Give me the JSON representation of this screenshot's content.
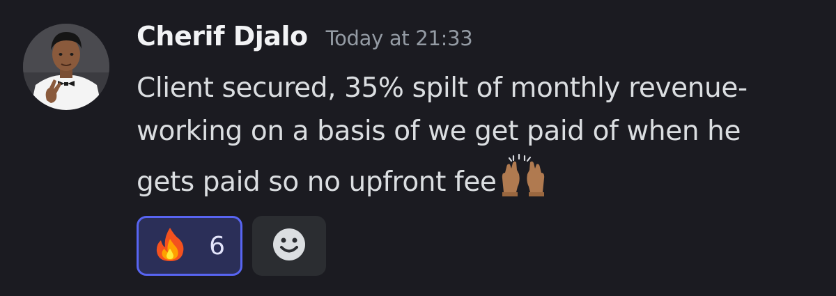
{
  "message": {
    "author": "Cherif Djalo",
    "timestamp": "Today at 21:33",
    "content_lines": [
      "Client secured, 35% spilt of monthly revenue-",
      "working on a basis of we get paid of when he",
      "gets paid so no upfront fee"
    ],
    "trailing_emoji": "raising-hands-icon"
  },
  "reactions": [
    {
      "emoji": "fire-icon",
      "count": "6",
      "selected": true
    }
  ],
  "add_reaction": {
    "icon": "smiley-face-icon"
  },
  "colors": {
    "background": "#1b1b21",
    "author": "#f2f3f5",
    "timestamp": "#949ba4",
    "text": "#dbdee1",
    "reaction_selected_bg": "#2b2f58",
    "reaction_selected_border": "#5865f2",
    "add_reaction_bg": "#2b2d31"
  }
}
